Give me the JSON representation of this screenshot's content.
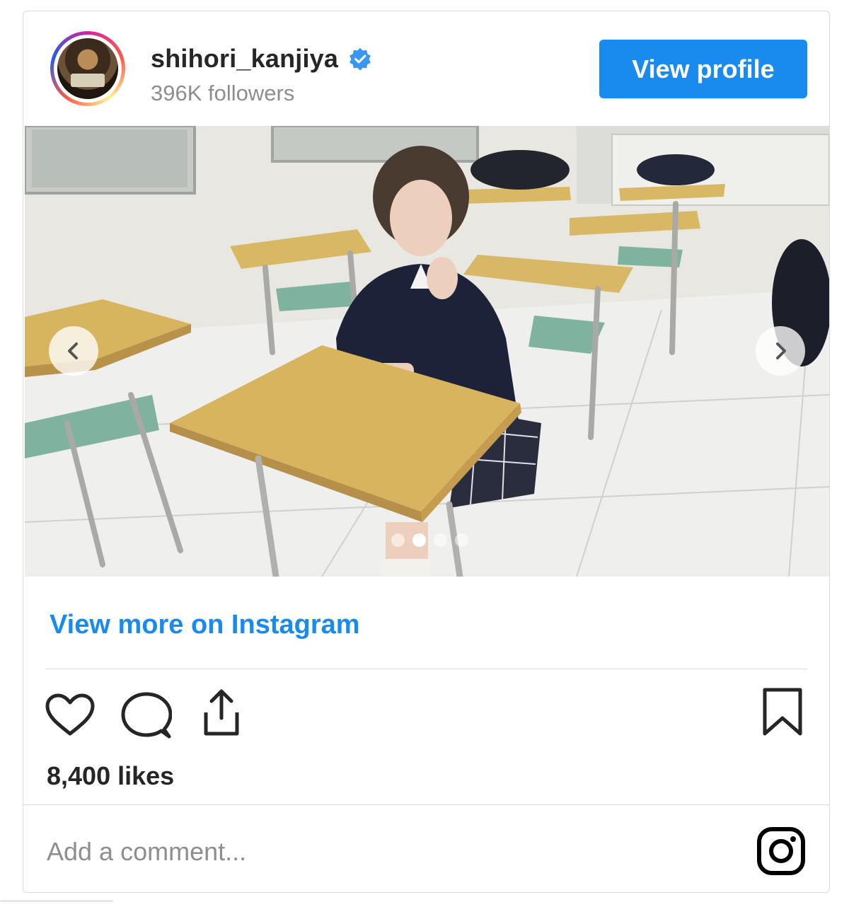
{
  "post": {
    "username": "shihori_kanjiya",
    "followers": "396K followers",
    "view_profile_label": "View profile",
    "view_more_label": "View more on Instagram",
    "likes": "8,400 likes",
    "comment_placeholder": "Add a comment...",
    "carousel": {
      "slide_count": 4,
      "active_index": 1
    }
  },
  "icons": {
    "verified": "verified-badge-icon",
    "prev": "chevron-left-icon",
    "next": "chevron-right-icon",
    "like": "heart-icon",
    "comment": "comment-bubble-icon",
    "share": "share-upload-icon",
    "save": "bookmark-icon",
    "brand": "instagram-logo-icon"
  },
  "colors": {
    "accent": "#1a8bee",
    "text": "#262626",
    "muted": "#8e8e8e",
    "border": "#dbdbdb"
  }
}
